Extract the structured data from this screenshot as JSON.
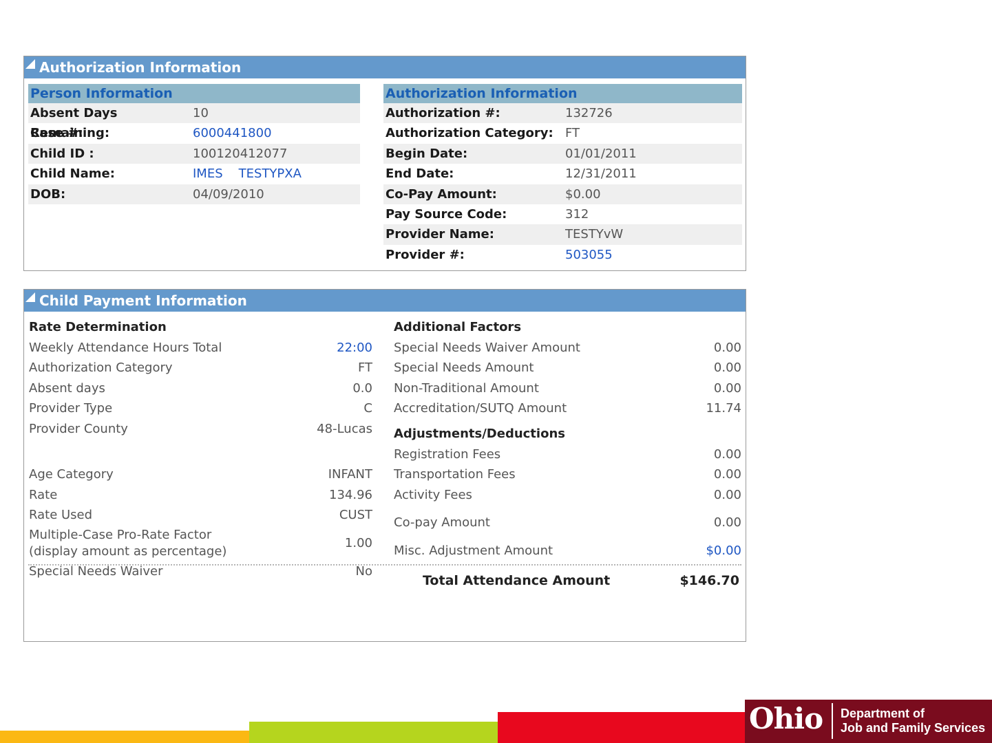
{
  "auth_panel": {
    "title": "Authorization Information",
    "person": {
      "title": "Person Information",
      "rows": [
        {
          "label": "Absent Days Remaining:",
          "value": "10"
        },
        {
          "label": "Case #:",
          "value": "6000441800"
        },
        {
          "label": "Child ID :",
          "value": "100120412077"
        },
        {
          "label": "Child Name:",
          "value_first": "IMES",
          "value_last": "TESTYPXA"
        },
        {
          "label": "DOB:",
          "value": "04/09/2010"
        }
      ]
    },
    "authorization": {
      "title": "Authorization Information",
      "rows": [
        {
          "label": "Authorization #:",
          "value": "132726"
        },
        {
          "label": "Authorization Category:",
          "value": "FT"
        },
        {
          "label": "Begin Date:",
          "value": "01/01/2011"
        },
        {
          "label": "End Date:",
          "value": "12/31/2011"
        },
        {
          "label": "Co-Pay Amount:",
          "value": "$0.00"
        },
        {
          "label": "Pay Source Code:",
          "value": "312"
        },
        {
          "label": "Provider Name:",
          "value": "TESTYvW"
        },
        {
          "label": "Provider #:",
          "value": "503055"
        }
      ]
    }
  },
  "payment_panel": {
    "title": "Child Payment Information",
    "rate": {
      "heading": "Rate Determination",
      "rows": [
        {
          "label": "Weekly Attendance Hours Total",
          "value": "22:00"
        },
        {
          "label": "Authorization Category",
          "value": "FT"
        },
        {
          "label": "Absent days",
          "value": "0.0"
        },
        {
          "label": "Provider Type",
          "value": "C"
        },
        {
          "label": "Provider County",
          "value": "48-Lucas"
        },
        {
          "label": "Age Category",
          "value": "INFANT"
        },
        {
          "label": "Rate",
          "value": "134.96"
        },
        {
          "label": "Rate Used",
          "value": "CUST"
        },
        {
          "label": "Multiple-Case Pro-Rate Factor",
          "label2": "(display amount as percentage)",
          "value": "1.00"
        },
        {
          "label": "Special Needs Waiver",
          "value": "No"
        }
      ]
    },
    "factors": {
      "heading": "Additional Factors",
      "rows": [
        {
          "label": "Special Needs Waiver Amount",
          "value": "0.00"
        },
        {
          "label": "Special Needs Amount",
          "value": "0.00"
        },
        {
          "label": "Non-Traditional Amount",
          "value": "0.00"
        },
        {
          "label": "Accreditation/SUTQ Amount",
          "value": "11.74"
        }
      ]
    },
    "adjustments": {
      "heading": "Adjustments/Deductions",
      "rows": [
        {
          "label": "Registration Fees",
          "value": "0.00"
        },
        {
          "label": "Transportation Fees",
          "value": "0.00"
        },
        {
          "label": "Activity Fees",
          "value": "0.00"
        },
        {
          "label": "Co-pay Amount",
          "value": "0.00"
        },
        {
          "label": "Misc. Adjustment Amount",
          "value": "$0.00"
        }
      ]
    },
    "total_label": "Total Attendance Amount",
    "total_value": "$146.70"
  },
  "footer": {
    "logo_text": "Ohio",
    "dept_line1": "Department of",
    "dept_line2": "Job and Family Services",
    "colors": {
      "yellow": "#fbb813",
      "green": "#b5d51e",
      "red": "#e8081e",
      "maroon": "#7a0c1e"
    }
  }
}
